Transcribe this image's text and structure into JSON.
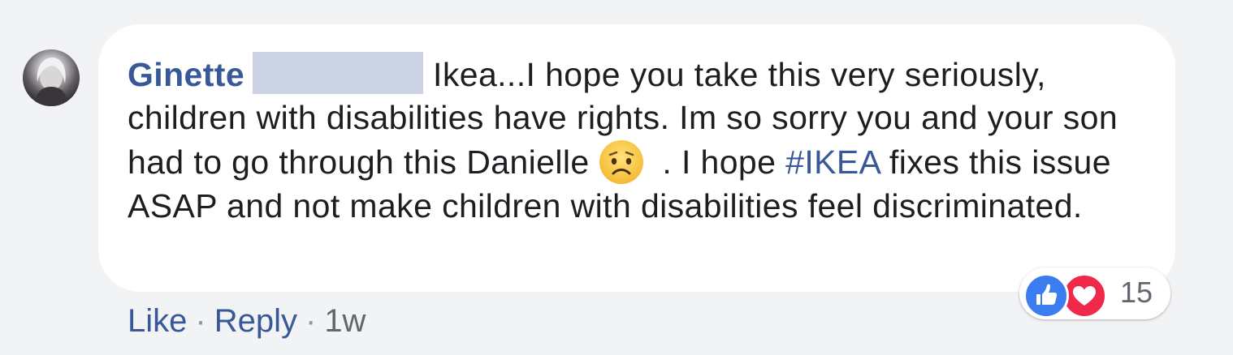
{
  "comment": {
    "author": "Ginette",
    "text_part1": "Ikea...I hope you take this very seriously, children with disabilities have rights. Im so sorry you and your son had to go through this Danielle",
    "emoji": "worried-face-icon",
    "text_part2": ". I hope",
    "hashtag": "#IKEA",
    "text_part3": "fixes this issue ASAP and not make children with disabilities feel discriminated."
  },
  "reactions": {
    "icons": [
      "like-icon",
      "love-icon"
    ],
    "count": "15"
  },
  "actions": {
    "like_label": "Like",
    "separator": "·",
    "reply_label": "Reply",
    "time": "1w"
  },
  "colors": {
    "background": "#f2f3f5",
    "bubble": "#ffffff",
    "link": "#385898",
    "text": "#1c1e21",
    "muted": "#606770",
    "redaction": "#cbd3e3",
    "like": "#3b7cf0",
    "love": "#f0284a"
  }
}
